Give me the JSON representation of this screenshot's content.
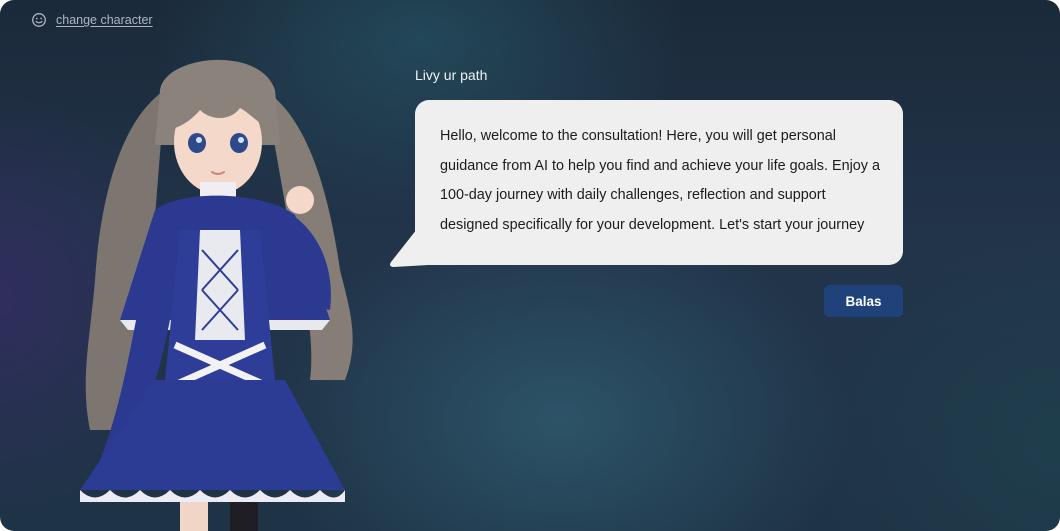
{
  "header": {
    "change_character_label": "change character",
    "icon": "smile-icon"
  },
  "chat": {
    "speaker_name": "Livy ur path",
    "message": "Hello, welcome to the consultation! Here, you will get personal guidance from AI to help you find and achieve your life goals. Enjoy a 100-day journey with daily challenges, reflection and support designed specifically for your development. Let's start your journey",
    "reply_button_label": "Balas"
  },
  "colors": {
    "bubble_background": "#efefef",
    "button_background": "#20427a",
    "speaker_text": "#eef2f5",
    "link_text": "#aeb6c0"
  }
}
